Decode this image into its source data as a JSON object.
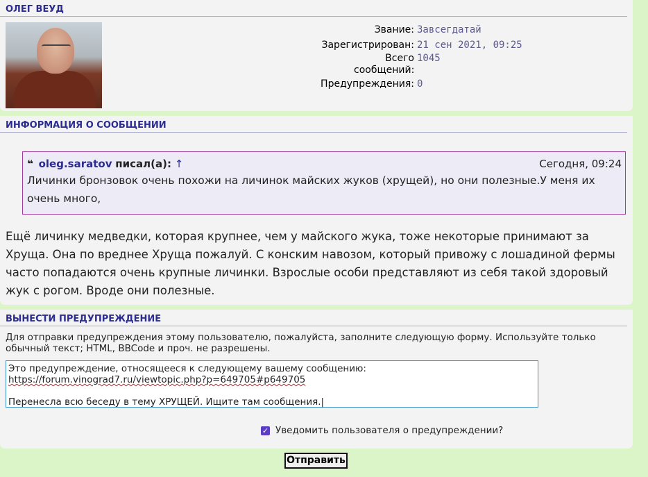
{
  "user": {
    "name": "ОЛЕГ ВЕУД",
    "fields": [
      {
        "label": "Звание:",
        "value": "Завсегдатай"
      },
      {
        "label": "Зарегистрирован:",
        "value": "21 сен 2021, 09:25"
      },
      {
        "label": "Всего сообщений:",
        "value": "1045"
      },
      {
        "label": "Предупреждения:",
        "value": "0"
      }
    ]
  },
  "post_info": {
    "heading": "ИНФОРМАЦИЯ О СООБЩЕНИИ",
    "quote": {
      "icon": "❝",
      "author": "oleg.saratov",
      "wrote": "писал(а):",
      "arrow": "↑",
      "time": "Сегодня, 09:24",
      "text": "Личинки бронзовок очень похожи на личинок майских жуков (хрущей), но они полезные.У меня их очень много,"
    },
    "body": "Ещё личинку медведки, которая крупнее, чем у майского жука, тоже некоторые принимают за Хруща. Она по вреднее Хруща пожалуй. С конским навозом, который привожу с лошадиной фермы часто попадаются очень крупные личинки. Взрослые особи представляют из себя такой здоровый жук с рогом. Вроде они полезные."
  },
  "warn": {
    "heading": "ВЫНЕСТИ ПРЕДУПРЕЖДЕНИЕ",
    "description": "Для отправки предупреждения этому пользователю, пожалуйста, заполните следующую форму. Используйте только обычный текст; HTML, BBCode и проч. не разрешены.",
    "textarea_line1": "Это предупреждение, относящееся к следующему вашему сообщению:",
    "textarea_link": "https://forum.vinograd7.ru/viewtopic.php?p=649705#p649705",
    "textarea_line3": "Перенесла всю беседу в тему ХРУЩЕЙ. Ищите там сообщения.",
    "notify_label": "Уведомить пользователя о предупреждении?",
    "notify_checked": true,
    "submit_label": "Отправить"
  },
  "colors": {
    "page_bg": "#dcf5c8",
    "panel_bg": "#f3f3f3",
    "heading": "#2c2c91",
    "quote_border": "#a03ca0",
    "checkbox": "#5b3cc4"
  }
}
